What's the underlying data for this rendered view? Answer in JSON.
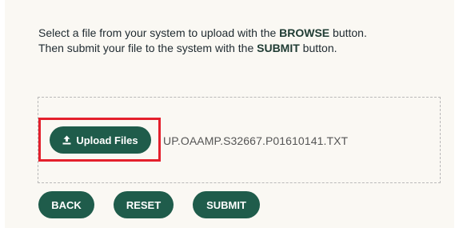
{
  "instructions": {
    "line1_pre": "Select a file from your system to upload with the ",
    "line1_bold": "BROWSE",
    "line1_post": " button.",
    "line2_pre": "Then submit your file to the system with the ",
    "line2_bold": "SUBMIT",
    "line2_post": " button."
  },
  "upload": {
    "button_label": "Upload Files",
    "icon": "upload-icon",
    "selected_file": "UP.OAAMP.S32667.P01610141.TXT"
  },
  "actions": {
    "back_label": "BACK",
    "reset_label": "RESET",
    "submit_label": "SUBMIT"
  },
  "colors": {
    "button_bg": "#1f5c4b",
    "highlight_border": "#e4202c",
    "panel_bg": "#faf8f3"
  }
}
